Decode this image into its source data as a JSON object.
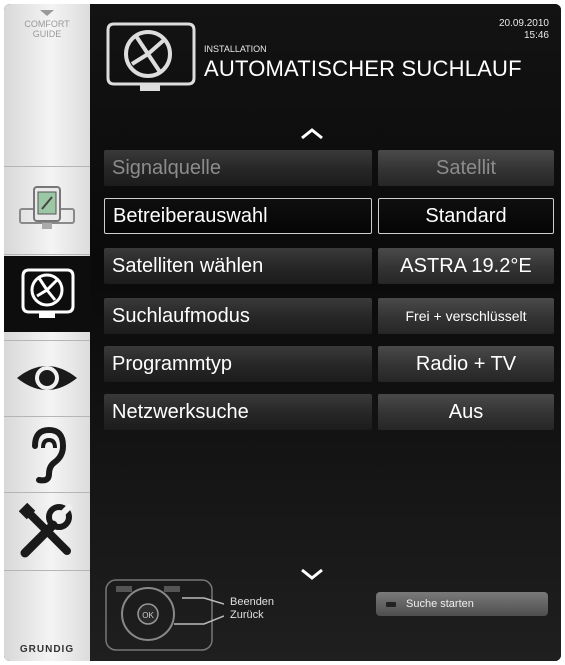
{
  "sidebar": {
    "comfort_line1": "COMFORT",
    "comfort_line2": "GUIDE",
    "brand": "GRUNDIG",
    "items": [
      {
        "icon": "source-tv-icon"
      },
      {
        "icon": "installation-satellite-icon"
      },
      {
        "icon": "picture-eye-icon"
      },
      {
        "icon": "sound-ear-icon"
      },
      {
        "icon": "settings-tools-icon"
      }
    ]
  },
  "header": {
    "date": "20.09.2010",
    "time": "15:46",
    "breadcrumb": "INSTALLATION",
    "title": "AUTOMATISCHER SUCHLAUF",
    "icon": "installation-satellite-icon"
  },
  "rows": [
    {
      "label": "Signalquelle",
      "value": "Satellit",
      "state": "disabled"
    },
    {
      "label": "Betreiberauswahl",
      "value": "Standard",
      "state": "selected"
    },
    {
      "label": "Satelliten wählen",
      "value": "ASTRA 19.2°E",
      "state": "normal"
    },
    {
      "label": "Suchlaufmodus",
      "value": "Frei + verschlüsselt",
      "state": "normal"
    },
    {
      "label": "Programmtyp",
      "value": "Radio + TV",
      "state": "normal"
    },
    {
      "label": "Netzwerksuche",
      "value": "Aus",
      "state": "normal"
    }
  ],
  "footer": {
    "legend_exit": "Beenden",
    "legend_back": "Zurück",
    "start_button": "Suche starten",
    "remote_center": "OK"
  },
  "colors": {
    "background": "#0d0d0d",
    "sidebar": "#f0f0f0",
    "selected_border": "#cfcfcf"
  }
}
